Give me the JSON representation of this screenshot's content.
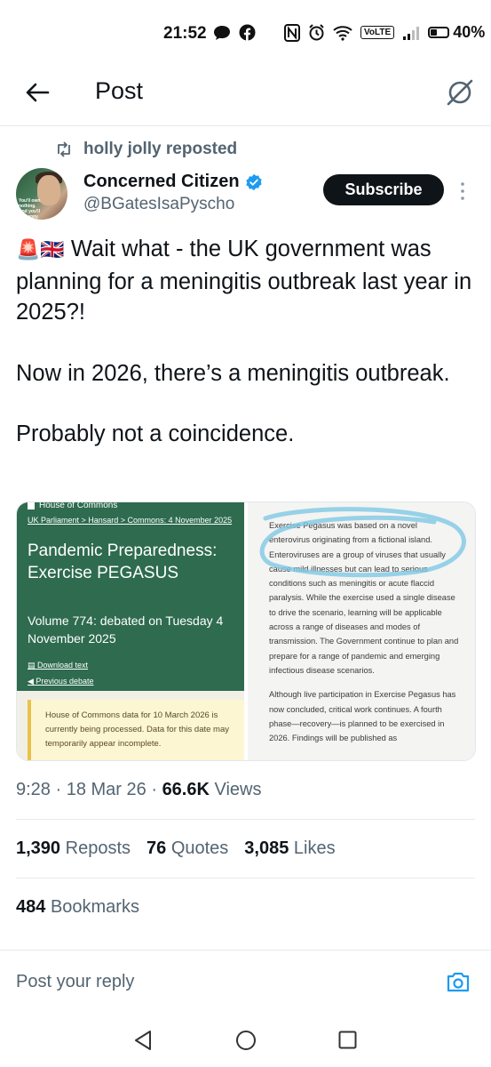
{
  "status_bar": {
    "time": "21:52",
    "volte": "VoLTE",
    "battery_percent": "40%",
    "battery_level": 0.4,
    "icons": [
      "chat-bubble-icon",
      "facebook-icon",
      "nfc-icon",
      "alarm-icon",
      "wifi-icon",
      "signal-icon",
      "battery-icon"
    ]
  },
  "header": {
    "title": "Post"
  },
  "post": {
    "repost_label": "holly jolly reposted",
    "author": {
      "name": "Concerned Citizen",
      "handle": "@BGatesIsaPyscho",
      "avatar_text": "You'll own nothing. And you'll be happy"
    },
    "subscribe_label": "Subscribe",
    "text": {
      "emojis": "🚨🇬🇧",
      "line1": "Wait what - the UK government was planning for a meningitis outbreak last year in 2025?!",
      "para2": "Now in 2026, there’s a meningitis outbreak.",
      "para3": "Probably not a coincidence."
    },
    "media_left": {
      "header": "House of Commons",
      "breadcrumb": "UK Parliament  >  Hansard  >  Commons: 4 November 2025",
      "title": "Pandemic Preparedness: Exercise PEGASUS",
      "volume": "Volume 774: debated on Tuesday 4 November 2025",
      "link1": "Download text",
      "link2": "Previous debate",
      "notice": "House of Commons data for 10 March 2026 is currently being processed. Data for this date may temporarily appear incomplete."
    },
    "media_right": {
      "top_fragment": "...",
      "para1": "Exercise Pegasus was based on a novel enterovirus originating from a fictional island. Enteroviruses are a group of viruses that usually cause mild illnesses but can lead to serious conditions such as meningitis or acute flaccid paralysis. While the exercise used a single disease to drive the scenario, learning will be applicable across a range of diseases and modes of transmission. The Government continue to plan and prepare for a range of pandemic and emerging infectious disease scenarios.",
      "para2": "Although live participation in Exercise Pegasus has now concluded, critical work continues. A fourth phase—recovery—is planned to be exercised in 2026. Findings will be published as"
    },
    "meta": {
      "time": "9:28",
      "date": "18 Mar 26",
      "views_count": "66.6K",
      "views_label": "Views"
    },
    "stats": {
      "reposts_count": "1,390",
      "reposts_label": "Reposts",
      "quotes_count": "76",
      "quotes_label": "Quotes",
      "likes_count": "3,085",
      "likes_label": "Likes",
      "bookmarks_count": "484",
      "bookmarks_label": "Bookmarks"
    }
  },
  "reply": {
    "placeholder": "Post your reply"
  },
  "colors": {
    "text_primary": "#0f1419",
    "text_secondary": "#536471",
    "accent": "#1d9bf0",
    "subscribe_bg": "#0f1419",
    "hoc_green": "#2e6b4f"
  }
}
